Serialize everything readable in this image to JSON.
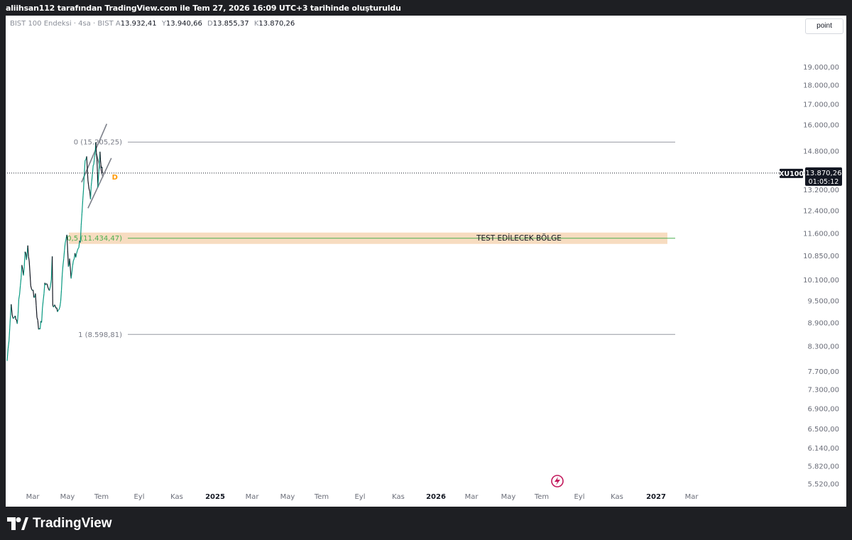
{
  "header": {
    "attribution": "aliihsan112 tarafından TradingView.com ile Tem 27, 2026 16:09 UTC+3 tarihinde oluşturuldu"
  },
  "legend": {
    "symbol": "BIST 100 Endeksi · 4sa · BIST",
    "open_label": "A",
    "open": "13.932,41",
    "high_label": "Y",
    "high": "13.940,66",
    "low_label": "D",
    "low": "13.855,37",
    "close_label": "K",
    "close": "13.870,26"
  },
  "toolbar": {
    "scale_button": "point"
  },
  "price_tag": {
    "ticker": "XU100",
    "price": "13.870,26",
    "countdown": "01:05:12"
  },
  "colors": {
    "candle_up": "#089981",
    "candle_down": "#131722",
    "zone_fill": "#f7dcc0",
    "fib_line": "#9598a1",
    "fib_mid": "#4caf50",
    "marker": "#ff9800"
  },
  "chart_data": {
    "type": "line",
    "title": "",
    "y_scale": "log",
    "ylim": [
      5400,
      21000
    ],
    "y_ticks": [
      "19.000,00",
      "18.000,00",
      "17.000,00",
      "16.000,00",
      "14.800,00",
      "13.200,00",
      "12.400,00",
      "11.600,00",
      "10.850,00",
      "10.100,00",
      "9.500,00",
      "8.900,00",
      "8.300,00",
      "7.700,00",
      "7.300,00",
      "6.900,00",
      "6.500,00",
      "6.140,00",
      "5.820,00",
      "5.520,00"
    ],
    "x_ticks": [
      "Mar",
      "May",
      "Tem",
      "Eyl",
      "Kas",
      "2025",
      "Mar",
      "May",
      "Tem",
      "Eyl",
      "Kas",
      "2026",
      "Mar",
      "May",
      "Tem",
      "Eyl",
      "Kas",
      "2027",
      "Mar"
    ],
    "series": [
      {
        "x": [
          "2024-01-01",
          "2024-01-20",
          "2024-02-10",
          "2024-03-01",
          "2024-03-20",
          "2024-04-10",
          "2024-04-25",
          "2024-05-10",
          "2024-05-25",
          "2024-06-10",
          "2024-06-25",
          "2024-07-10",
          "2024-07-22",
          "2024-08-05",
          "2024-08-20",
          "2024-09-05",
          "2024-09-20",
          "2024-10-05",
          "2024-10-20",
          "2024-11-05",
          "2024-11-20",
          "2024-12-05",
          "2024-12-20",
          "2025-01-05",
          "2025-01-20",
          "2025-02-05",
          "2025-02-20",
          "2025-03-10",
          "2025-03-19",
          "2025-03-24",
          "2025-04-10",
          "2025-04-25",
          "2025-05-10",
          "2025-05-25",
          "2025-06-10",
          "2025-06-25",
          "2025-07-10",
          "2025-07-25",
          "2025-08-10",
          "2025-08-25",
          "2025-09-05",
          "2025-09-20",
          "2025-10-05",
          "2025-10-20",
          "2025-11-05",
          "2025-11-20",
          "2025-12-05",
          "2025-12-20",
          "2026-01-05",
          "2026-01-20",
          "2026-02-05",
          "2026-02-20",
          "2026-03-05",
          "2026-03-15",
          "2026-03-30",
          "2026-04-10",
          "2026-04-25",
          "2026-05-05",
          "2026-05-10",
          "2026-05-20",
          "2026-06-01",
          "2026-06-10",
          "2026-06-20",
          "2026-07-01",
          "2026-07-10",
          "2026-07-20",
          "2026-07-27"
        ],
        "values": [
          7950,
          8500,
          9400,
          8950,
          9100,
          8850,
          9550,
          9900,
          10550,
          10300,
          10900,
          10800,
          11100,
          10700,
          9900,
          9850,
          9600,
          9700,
          9100,
          8750,
          8800,
          8950,
          9500,
          10000,
          9950,
          9950,
          9800,
          10200,
          10800,
          9300,
          9400,
          9300,
          9200,
          9300,
          9450,
          10300,
          10700,
          11200,
          11500,
          10500,
          10800,
          10200,
          10500,
          10800,
          10900,
          11000,
          11200,
          11300,
          12300,
          13300,
          14300,
          14700,
          13500,
          13200,
          12900,
          13600,
          14300,
          14400,
          14500,
          15200,
          14500,
          13400,
          14000,
          14700,
          14300,
          14100,
          13870
        ]
      }
    ],
    "fib_levels": [
      {
        "label": "0 (15.205,25)",
        "value": 15205.25
      },
      {
        "label": "0,5 (11.434,47)",
        "value": 11434.47
      },
      {
        "label": "1 (8.598,81)",
        "value": 8598.81
      }
    ],
    "annotation": "TEST EDİLECEK BÖLGE",
    "marker_label": "D"
  },
  "footer": {
    "brand": "TradingView"
  }
}
